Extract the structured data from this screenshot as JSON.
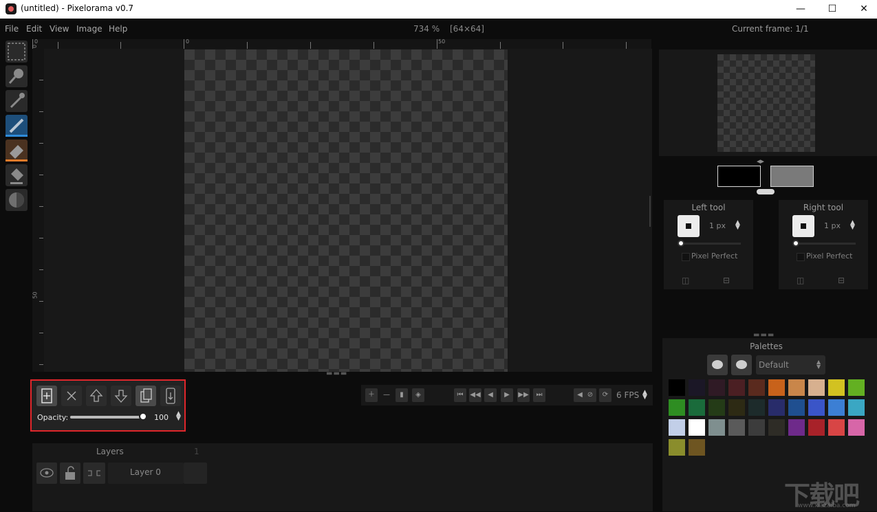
{
  "window": {
    "title": "(untitled) - Pixelorama v0.7",
    "minimize": "—",
    "maximize": "☐",
    "close": "✕"
  },
  "menu": [
    "File",
    "Edit",
    "View",
    "Image",
    "Help"
  ],
  "status": {
    "zoom": "734 %",
    "canvas_size": "[64×64]",
    "current_frame": "Current frame: 1/1"
  },
  "tools": [
    {
      "name": "rectangle-select",
      "active": false
    },
    {
      "name": "zoom",
      "active": false
    },
    {
      "name": "color-picker",
      "active": false
    },
    {
      "name": "pencil",
      "active": true,
      "color": "#2f8bd8"
    },
    {
      "name": "eraser",
      "active": true,
      "color": "#e07b2a"
    },
    {
      "name": "bucket",
      "active": false
    },
    {
      "name": "lighten-darken",
      "active": false
    }
  ],
  "rulers": {
    "horizontal_labels": [
      "0",
      "0",
      "50"
    ],
    "vertical_labels": [
      "0",
      "50"
    ]
  },
  "layer_toolbar": {
    "opacity_label": "Opacity:",
    "opacity_value": "100",
    "opacity_fraction": 1.0
  },
  "animation": {
    "fps": "6 FPS"
  },
  "layers": {
    "title": "Layers",
    "count": "1",
    "items": [
      {
        "name": "Layer 0"
      }
    ]
  },
  "tool_options": {
    "left": {
      "title": "Left tool",
      "size": "1 px",
      "pixel_perfect": "Pixel Perfect"
    },
    "right": {
      "title": "Right tool",
      "size": "1 px",
      "pixel_perfect": "Pixel Perfect"
    }
  },
  "colors": {
    "left": "#000000",
    "right": "#7a7a7a",
    "highlight": "#e0262b"
  },
  "palettes": {
    "title": "Palettes",
    "selected": "Default",
    "swatches": [
      "#000000",
      "#1b1726",
      "#2f1a25",
      "#4b1f23",
      "#5a2a1e",
      "#c8621b",
      "#c9864a",
      "#d7b08f",
      "#d2c221",
      "#63b022",
      "#2e8d22",
      "#1a6b3b",
      "#243b17",
      "#2d2a14",
      "#1d2b2b",
      "#282c6a",
      "#1f4f90",
      "#3a55c8",
      "#3c7fd4",
      "#3aa7c3",
      "#c2cfe8",
      "#ffffff",
      "#7f8f8f",
      "#5a5a5a",
      "#3c3c3c",
      "#2e2c26",
      "#6e2a8a",
      "#a82229",
      "#d84545",
      "#d766a8",
      "#8a8d2c",
      "#6e5521"
    ]
  },
  "watermark": {
    "text": "下载吧",
    "sub": "www.xiazaiba.com"
  }
}
